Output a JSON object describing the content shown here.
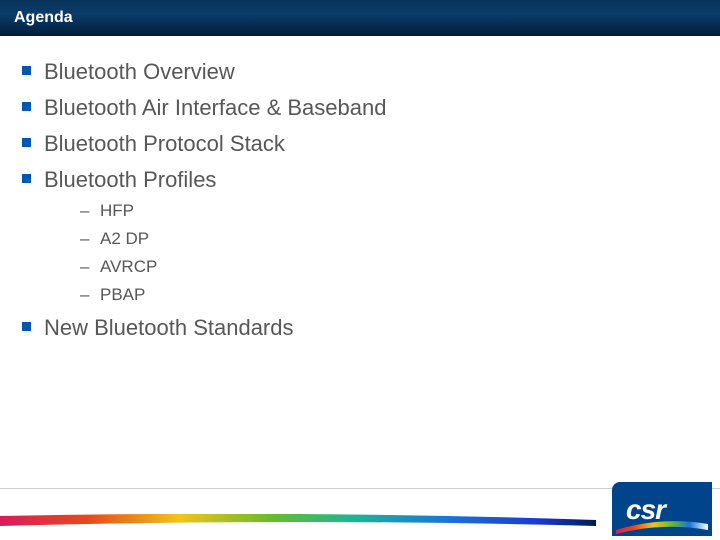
{
  "title": "Agenda",
  "bullets": {
    "b0": "Bluetooth Overview",
    "b1": "Bluetooth Air Interface & Baseband",
    "b2": "Bluetooth Protocol Stack",
    "b3": "Bluetooth Profiles",
    "sub": {
      "s0": "HFP",
      "s1": "A2 DP",
      "s2": "AVRCP",
      "s3": "PBAP"
    },
    "b4": "New Bluetooth Standards"
  },
  "logo_text": "csr",
  "colors": {
    "title_bar": "#0b3c6b",
    "bullet_square": "#0057b6",
    "text": "#575757",
    "logo_bg": "#00458c"
  }
}
